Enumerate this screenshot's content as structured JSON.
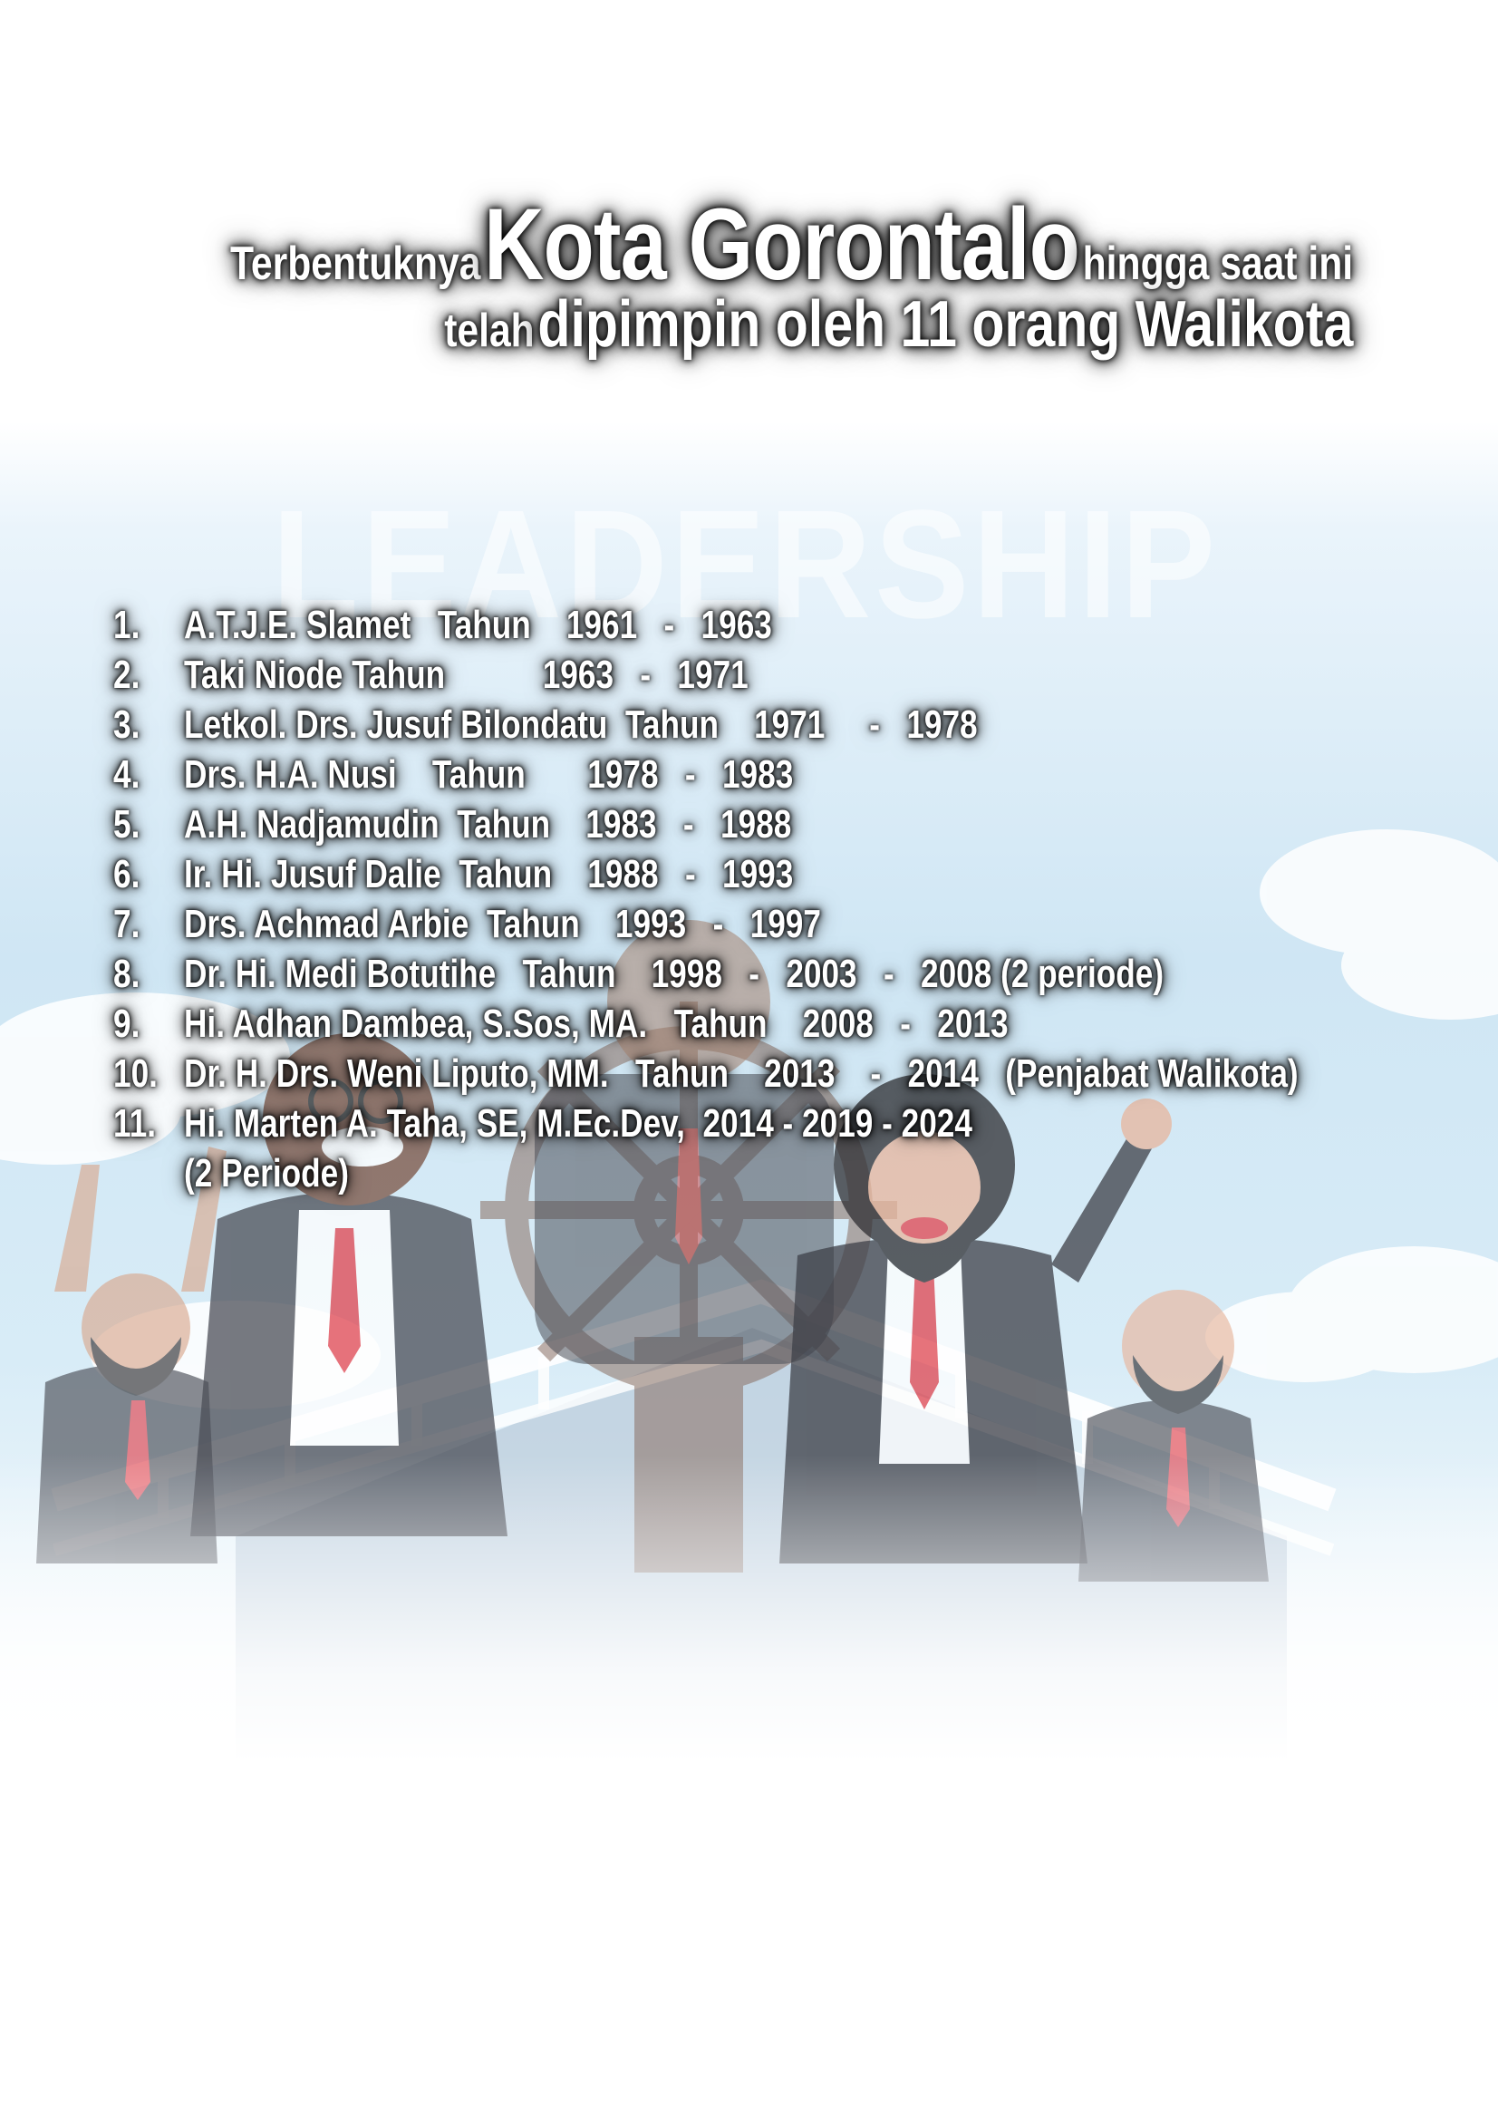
{
  "heading": {
    "line1_a": "Terbentuknya",
    "line1_b": "Kota Gorontalo",
    "line1_c": "hingga saat ini",
    "line2_a": "telah",
    "line2_b": "dipimpin oleh 11 orang Walikota"
  },
  "watermark": "LEADERSHIP",
  "walikota": [
    {
      "no": "1.",
      "text": "A.T.J.E. Slamet   Tahun    1961   -   1963"
    },
    {
      "no": "2.",
      "text": "Taki Niode Tahun           1963   -   1971"
    },
    {
      "no": "3.",
      "text": "Letkol. Drs. Jusuf Bilondatu  Tahun    1971     -   1978"
    },
    {
      "no": "4.",
      "text": "Drs. H.A. Nusi    Tahun       1978   -   1983"
    },
    {
      "no": "5.",
      "text": "A.H. Nadjamudin  Tahun    1983   -   1988"
    },
    {
      "no": "6.",
      "text": "Ir. Hi. Jusuf Dalie  Tahun    1988   -   1993"
    },
    {
      "no": "7.",
      "text": "Drs. Achmad Arbie  Tahun    1993   -   1997"
    },
    {
      "no": "8.",
      "text": "Dr. Hi. Medi Botutihe   Tahun    1998   -   2003   -   2008 (2 periode)"
    },
    {
      "no": "9.",
      "text": "Hi. Adhan Dambea, S.Sos, MA.   Tahun    2008   -   2013"
    },
    {
      "no": "10.",
      "text": "Dr. H. Drs. Weni Liputo, MM.   Tahun    2013    -   2014   (Penjabat Walikota)"
    },
    {
      "no": "11.",
      "text": "Hi. Marten A. Taha, SE, M.Ec.Dev,  2014 - 2019 - 2024"
    },
    {
      "no": "",
      "text": "(2 Periode)"
    }
  ]
}
